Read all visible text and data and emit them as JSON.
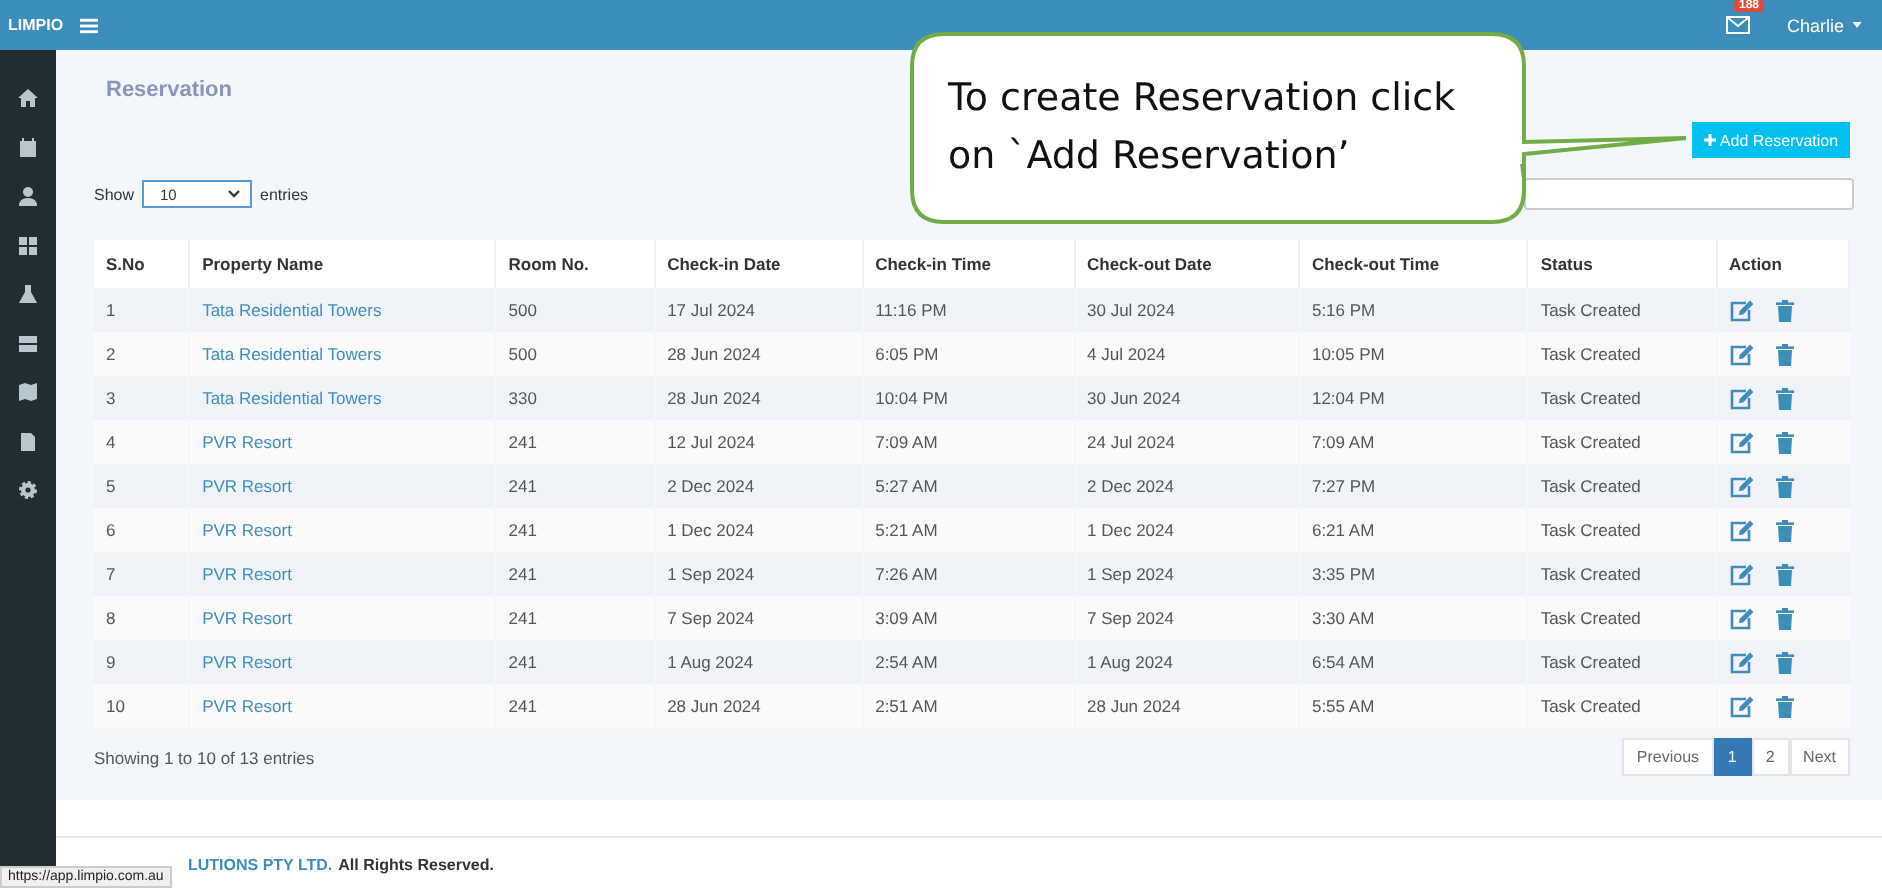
{
  "topbar": {
    "logo": "LIMPIO",
    "mail_badge": "188",
    "user": "Charlie"
  },
  "page": {
    "title": "Reservation",
    "add_button": "Add Reservation"
  },
  "callout": {
    "lines": [
      "To create Reservation click",
      "on `Add Reservation’"
    ]
  },
  "length": {
    "before": "Show",
    "value": "10",
    "after": "entries"
  },
  "table": {
    "columns": [
      "S.No",
      "Property Name",
      "Room No.",
      "Check-in Date",
      "Check-in Time",
      "Check-out Date",
      "Check-out Time",
      "Status",
      "Action"
    ],
    "rows": [
      {
        "sno": "1",
        "property": "Tata Residential Towers",
        "room": "500",
        "checkin_date": "17 Jul 2024",
        "checkin_time": "11:16 PM",
        "checkout_date": "30 Jul 2024",
        "checkout_time": "5:16 PM",
        "status": "Task Created"
      },
      {
        "sno": "2",
        "property": "Tata Residential Towers",
        "room": "500",
        "checkin_date": "28 Jun 2024",
        "checkin_time": "6:05 PM",
        "checkout_date": "4 Jul 2024",
        "checkout_time": "10:05 PM",
        "status": "Task Created"
      },
      {
        "sno": "3",
        "property": "Tata Residential Towers",
        "room": "330",
        "checkin_date": "28 Jun 2024",
        "checkin_time": "10:04 PM",
        "checkout_date": "30 Jun 2024",
        "checkout_time": "12:04 PM",
        "status": "Task Created"
      },
      {
        "sno": "4",
        "property": "PVR Resort",
        "room": "241",
        "checkin_date": "12 Jul 2024",
        "checkin_time": "7:09 AM",
        "checkout_date": "24 Jul 2024",
        "checkout_time": "7:09 AM",
        "status": "Task Created"
      },
      {
        "sno": "5",
        "property": "PVR Resort",
        "room": "241",
        "checkin_date": "2 Dec 2024",
        "checkin_time": "5:27 AM",
        "checkout_date": "2 Dec 2024",
        "checkout_time": "7:27 PM",
        "status": "Task Created"
      },
      {
        "sno": "6",
        "property": "PVR Resort",
        "room": "241",
        "checkin_date": "1 Dec 2024",
        "checkin_time": "5:21 AM",
        "checkout_date": "1 Dec 2024",
        "checkout_time": "6:21 AM",
        "status": "Task Created"
      },
      {
        "sno": "7",
        "property": "PVR Resort",
        "room": "241",
        "checkin_date": "1 Sep 2024",
        "checkin_time": "7:26 AM",
        "checkout_date": "1 Sep 2024",
        "checkout_time": "3:35 PM",
        "status": "Task Created"
      },
      {
        "sno": "8",
        "property": "PVR Resort",
        "room": "241",
        "checkin_date": "7 Sep 2024",
        "checkin_time": "3:09 AM",
        "checkout_date": "7 Sep 2024",
        "checkout_time": "3:30 AM",
        "status": "Task Created"
      },
      {
        "sno": "9",
        "property": "PVR Resort",
        "room": "241",
        "checkin_date": "1 Aug 2024",
        "checkin_time": "2:54 AM",
        "checkout_date": "1 Aug 2024",
        "checkout_time": "6:54 AM",
        "status": "Task Created"
      },
      {
        "sno": "10",
        "property": "PVR Resort",
        "room": "241",
        "checkin_date": "28 Jun 2024",
        "checkin_time": "2:51 AM",
        "checkout_date": "28 Jun 2024",
        "checkout_time": "5:55 AM",
        "status": "Task Created"
      }
    ]
  },
  "info": "Showing 1 to 10 of 13 entries",
  "pagination": [
    {
      "label": "Previous",
      "kind": "nav",
      "selected": false
    },
    {
      "label": "1",
      "kind": "page",
      "selected": true
    },
    {
      "label": "2",
      "kind": "page",
      "selected": false
    },
    {
      "label": "Next",
      "kind": "nav",
      "selected": false
    }
  ],
  "footer": {
    "company": "LUTIONS PTY LTD.",
    "rights": "All Rights Reserved."
  },
  "status_url": "https://app.limpio.com.au"
}
